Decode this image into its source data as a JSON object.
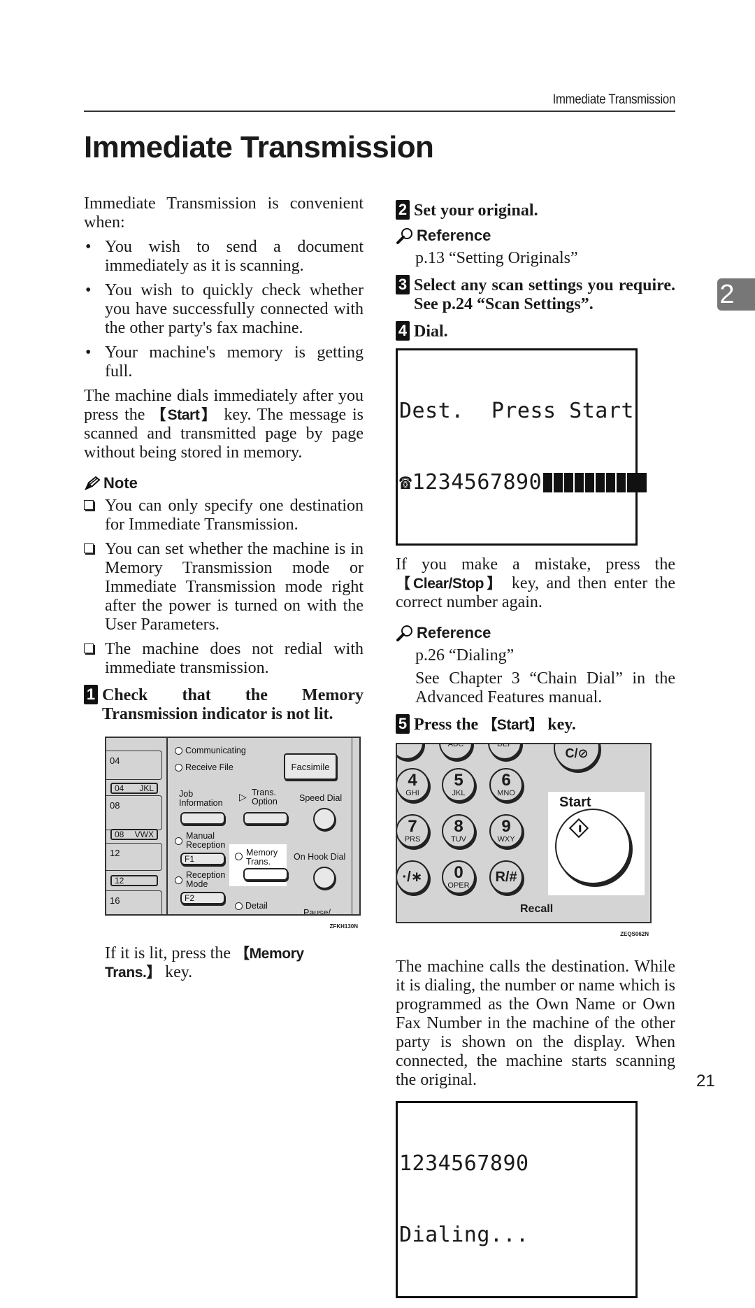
{
  "header": {
    "running_title": "Immediate Transmission",
    "page_title": "Immediate Transmission"
  },
  "chapter_tab": "2",
  "page_number": "21",
  "left": {
    "intro": "Immediate Transmission is convenient when:",
    "bullets": [
      "You wish to send a document immediately as it is scanning.",
      "You wish to quickly check whether you have successfully connected with the other party's fax machine.",
      "Your machine's memory is getting full."
    ],
    "para_before_key": "The machine dials immediately after you press the ",
    "para_key": "【Start】",
    "para_after_key": " key. The message is scanned and transmitted page by page without being stored in memory.",
    "note_heading": "Note",
    "notes": [
      "You can only specify one destination for Immediate Transmission.",
      "You can set whether the machine is in Memory Transmission mode or Immediate Transmission mode right after the power is turned on with the User Parameters.",
      "The machine does not redial with immediate transmission."
    ],
    "step1": {
      "number": "1",
      "text": "Check that the Memory Transmission indicator is not lit."
    },
    "panel": {
      "slots": [
        "04",
        "08",
        "12",
        "16"
      ],
      "tabs": [
        {
          "num": "04",
          "letters": "JKL"
        },
        {
          "num": "08",
          "letters": "VWX"
        },
        {
          "num": "12",
          "letters": ""
        }
      ],
      "indicators": {
        "communicating": "Communicating",
        "receive_file": "Receive File",
        "manual_reception_1": "Manual",
        "manual_reception_2": "Reception",
        "reception_mode_1": "Reception",
        "reception_mode_2": "Mode",
        "memory_trans_1": "Memory",
        "memory_trans_2": "Trans.",
        "detail": "Detail"
      },
      "buttons": {
        "facsimile": "Facsimile",
        "job_info_1": "Job",
        "job_info_2": "Information",
        "trans_option_1": "Trans.",
        "trans_option_2": "Option",
        "speed_dial": "Speed Dial",
        "on_hook_dial": "On Hook Dial",
        "f1": "F1",
        "f2": "F2",
        "pause": "Pause/"
      },
      "figure_code": "ZFKH130N"
    },
    "if_lit_before": "If it is lit, press the ",
    "if_lit_key": "【Memory Trans.】",
    "if_lit_after": " key."
  },
  "right": {
    "step2": {
      "number": "2",
      "text": "Set your original."
    },
    "ref1_heading": "Reference",
    "ref1_items": [
      "p.13 “Setting Originals”"
    ],
    "step3": {
      "number": "3",
      "text": "Select any scan settings you require. See p.24 “Scan Settings”."
    },
    "step4": {
      "number": "4",
      "text": "Dial."
    },
    "lcd1": {
      "row1_left": "Dest.",
      "row1_right": "Press Start",
      "row2_number": "1234567890",
      "phone_icon": "☎"
    },
    "mistake_before": "If you make a mistake, press the ",
    "mistake_key": "【Clear/Stop】",
    "mistake_after": " key, and then enter the correct number again.",
    "ref2_heading": "Reference",
    "ref2_items": [
      "p.26 “Dialing”",
      "See Chapter 3 “Chain Dial” in the Advanced Features manual."
    ],
    "step5": {
      "number": "5",
      "text_before": "Press the ",
      "key": "【Start】",
      "text_after": " key."
    },
    "keypad": {
      "keys": [
        {
          "digit": "",
          "letters": "ABC"
        },
        {
          "digit": "",
          "letters": "DEF"
        },
        {
          "digit": "4",
          "letters": "GHI"
        },
        {
          "digit": "5",
          "letters": "JKL"
        },
        {
          "digit": "6",
          "letters": "MNO"
        },
        {
          "digit": "7",
          "letters": "PRS"
        },
        {
          "digit": "8",
          "letters": "TUV"
        },
        {
          "digit": "9",
          "letters": "WXY"
        },
        {
          "digit": "·/∗",
          "letters": ""
        },
        {
          "digit": "0",
          "letters": "OPER"
        },
        {
          "digit": "R/#",
          "letters": ""
        }
      ],
      "clear_stop_label": "C/⊘",
      "start_label": "Start",
      "recall_label": "Recall",
      "figure_code": "ZEQS062N"
    },
    "calls_paragraph": "The machine calls the destination. While it is dialing, the number or name which is programmed as the Own Name or Own Fax Number in the machine of the other party is shown on the display. When connected, the machine starts scanning the original.",
    "lcd2": {
      "row1": "1234567890",
      "row2": "Dialing..."
    }
  }
}
